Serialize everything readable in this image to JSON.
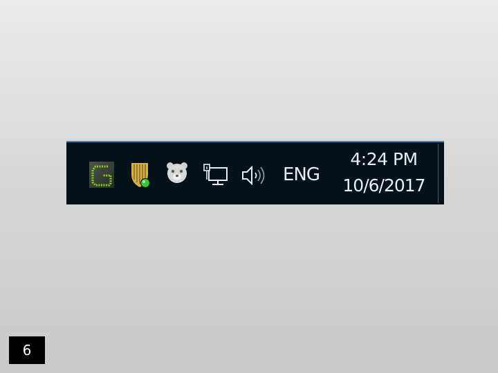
{
  "taskbar": {
    "tray_icons": [
      {
        "name": "green-g-app-icon",
        "color": "#7ed321"
      },
      {
        "name": "security-shield-icon",
        "color": "#d4b24a",
        "status_color": "#3cc43c"
      },
      {
        "name": "bear-app-icon",
        "color": "#d8d8d8"
      },
      {
        "name": "network-icon"
      },
      {
        "name": "volume-icon"
      }
    ],
    "language": "ENG",
    "clock": {
      "time": "4:24 PM",
      "date": "10/6/2017"
    },
    "colors": {
      "background": "#05121a",
      "accent": "#3b8fc0",
      "text": "#e8eef2"
    }
  },
  "slide": {
    "number": "6"
  }
}
